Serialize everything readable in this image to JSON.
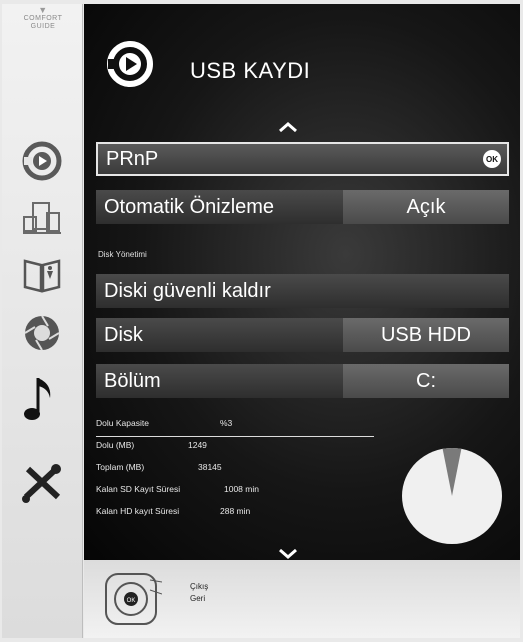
{
  "sidebar": {
    "comfort_guide": "COMFORT GUIDE",
    "icons": [
      "record-icon",
      "devices-icon",
      "book-icon",
      "lens-icon",
      "music-icon",
      "tools-icon"
    ]
  },
  "header": {
    "title": "USB KAYDI",
    "icon": "record-icon"
  },
  "menu": {
    "prnp": {
      "label": "PRnP",
      "ok": "OK"
    },
    "preview": {
      "label": "Otomatik Önizleme",
      "value": "Açık"
    },
    "section_title": "Disk Yönetimi",
    "remove_disk": {
      "label": "Diski güvenli kaldır"
    },
    "disk": {
      "label": "Disk",
      "value": "USB HDD"
    },
    "partition": {
      "label": "Bölüm",
      "value": "C:"
    }
  },
  "disk_info": {
    "capacity": {
      "label": "Dolu Kapasite",
      "value": "%3"
    },
    "used": {
      "label": "Dolu (MB)",
      "value": "1249"
    },
    "total": {
      "label": "Toplam (MB)",
      "value": "38145"
    },
    "sd_time": {
      "label": "Kalan SD Kayıt Süresi",
      "value": "1008 min"
    },
    "hd_time": {
      "label": "Kalan HD kayıt Süresi",
      "value": "288 min"
    },
    "used_fraction": 0.03
  },
  "footer": {
    "exit": "Çıkış",
    "back": "Geri"
  },
  "colors": {
    "panel": "#111111",
    "row": "#3a3a3a",
    "value_box": "#5a5a5a",
    "pie_free": "#f0f0f0",
    "pie_used": "#7a7a7a"
  }
}
